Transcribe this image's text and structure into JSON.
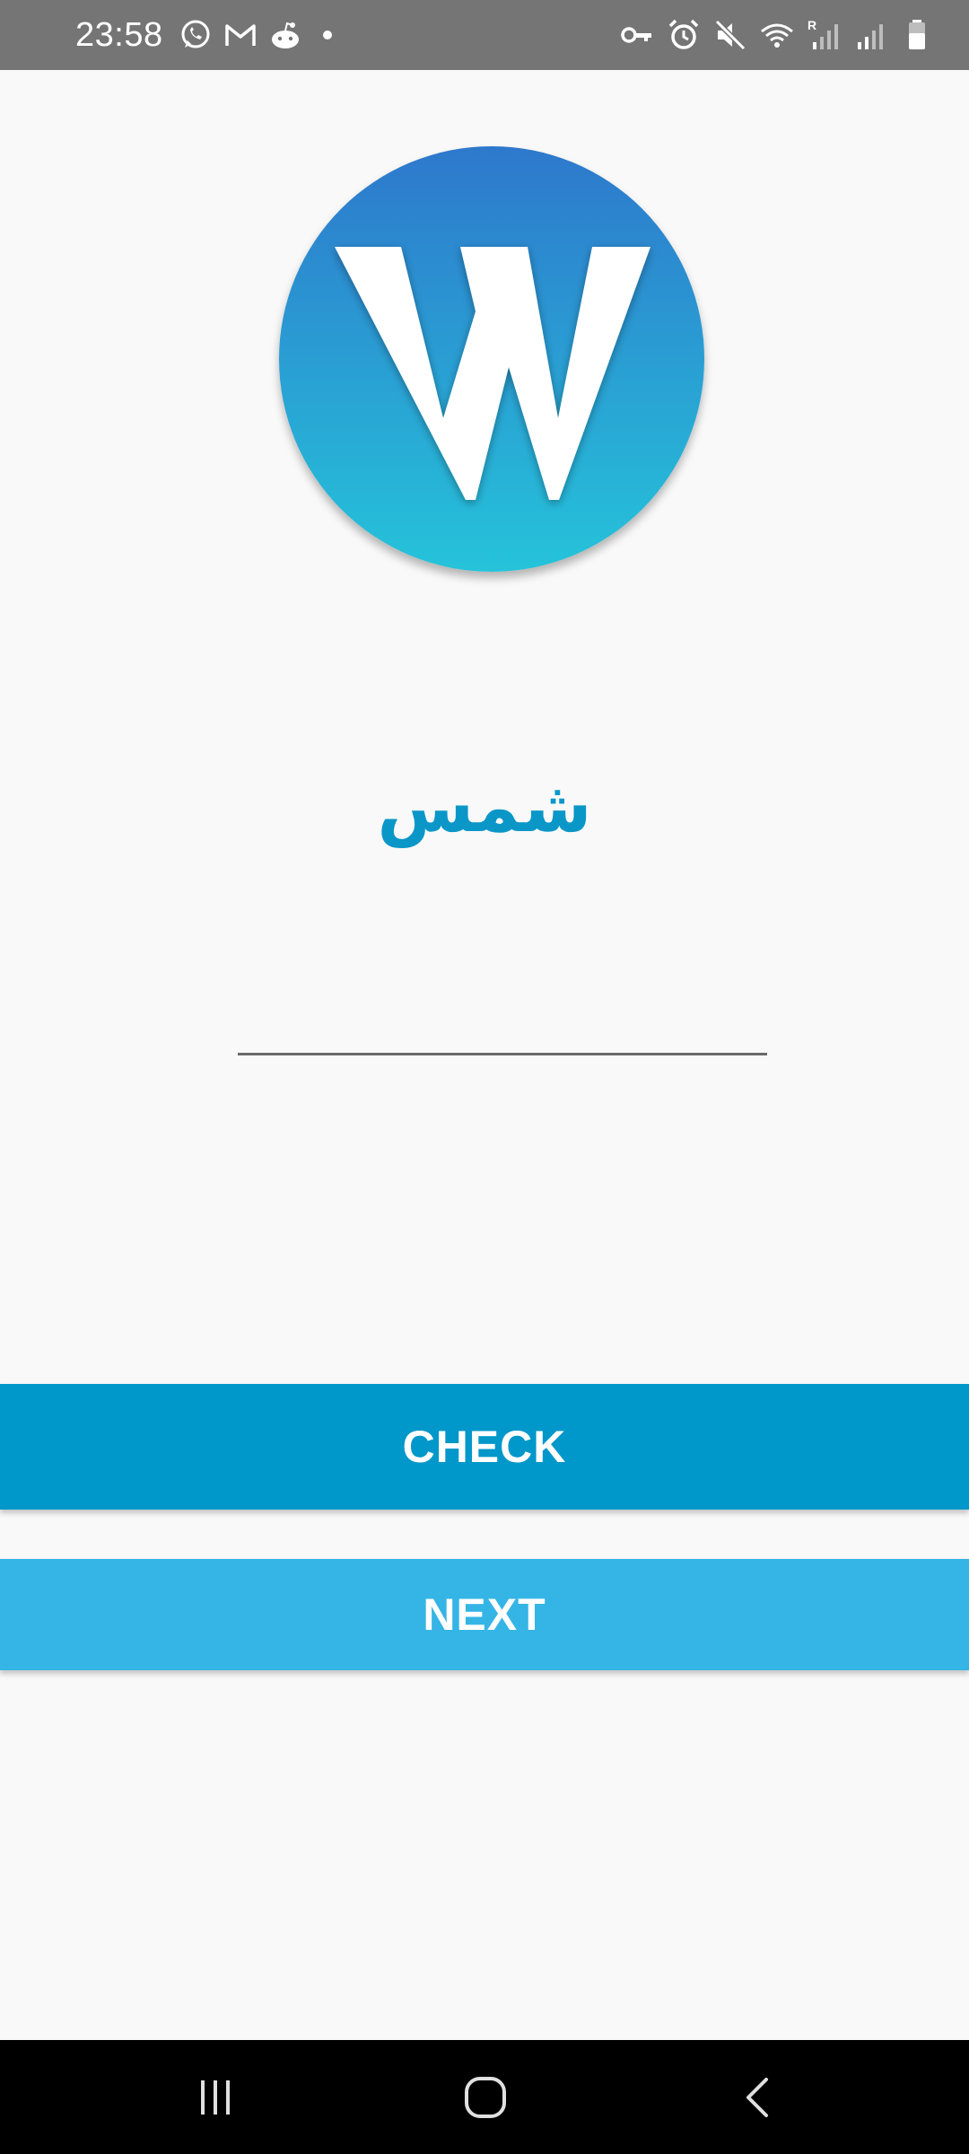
{
  "status_bar": {
    "time": "23:58",
    "left_icons": [
      "whatsapp-icon",
      "gmail-icon",
      "reddit-icon",
      "notification-dot"
    ],
    "right_icons": [
      "vpn-key-icon",
      "alarm-icon",
      "mute-icon",
      "wifi-icon",
      "signal-roaming-icon",
      "signal-icon",
      "battery-icon"
    ],
    "roaming_label": "R"
  },
  "logo": {
    "letter": "W",
    "gradient_top": "#2e78cc",
    "gradient_bottom": "#25c3da"
  },
  "word": {
    "text": "شمس",
    "color": "#0a97c8"
  },
  "answer": {
    "value": "",
    "placeholder": ""
  },
  "buttons": {
    "check_label": "CHECK",
    "next_label": "NEXT",
    "check_color": "#0097ca",
    "next_color": "#35b5e5"
  },
  "nav_bar": {
    "icons": [
      "recent-apps-icon",
      "home-icon",
      "back-icon"
    ]
  }
}
